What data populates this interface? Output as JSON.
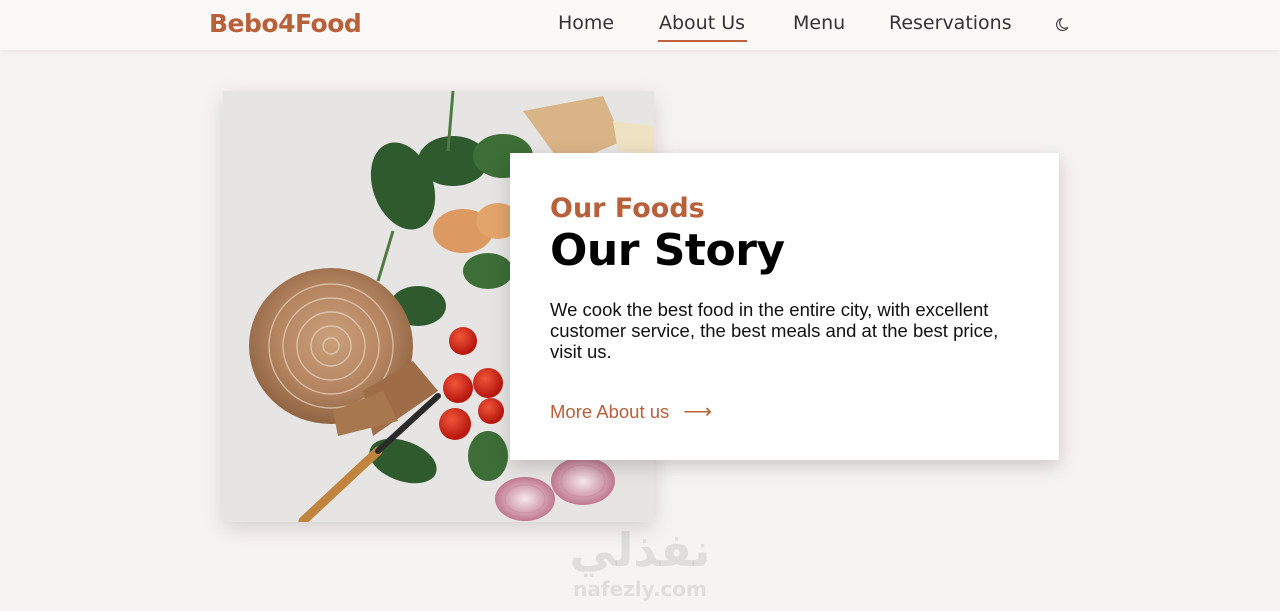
{
  "brand": {
    "name": "Bebo4Food",
    "color": "#b8603a"
  },
  "nav": {
    "items": [
      {
        "label": "Home",
        "active": false
      },
      {
        "label": "About Us",
        "active": true
      },
      {
        "label": "Menu",
        "active": false
      },
      {
        "label": "Reservations",
        "active": false
      }
    ],
    "theme_toggle_icon": "moon-icon"
  },
  "hero": {
    "image_icon": "food-photo",
    "card": {
      "subtitle": "Our Foods",
      "title": "Our Story",
      "text": "We cook the best food in the entire city, with excellent customer service, the best meals and at the best price, visit us.",
      "link_label": "More About us",
      "link_arrow": "⟶"
    }
  },
  "watermark": {
    "arabic": "نفذلي",
    "latin": "nafezly.com"
  },
  "colors": {
    "accent": "#b8603a",
    "background": "#f8f3f3",
    "card": "#ffffff"
  }
}
